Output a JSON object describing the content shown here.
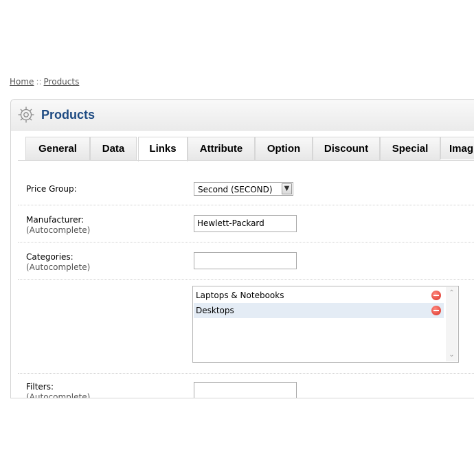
{
  "breadcrumb": {
    "home": "Home",
    "separator": "::",
    "products": "Products"
  },
  "heading": {
    "title": "Products",
    "icon": "gear-icon"
  },
  "tabs": [
    {
      "label": "General",
      "active": false
    },
    {
      "label": "Data",
      "active": false
    },
    {
      "label": "Links",
      "active": true
    },
    {
      "label": "Attribute",
      "active": false
    },
    {
      "label": "Option",
      "active": false
    },
    {
      "label": "Discount",
      "active": false
    },
    {
      "label": "Special",
      "active": false
    },
    {
      "label": "Imag",
      "active": false
    }
  ],
  "form": {
    "price_group": {
      "label": "Price Group:",
      "value": "Second (SECOND)"
    },
    "manufacturer": {
      "label": "Manufacturer:",
      "help": "(Autocomplete)",
      "value": "Hewlett-Packard"
    },
    "categories": {
      "label": "Categories:",
      "help": "(Autocomplete)",
      "value": ""
    },
    "category_list": [
      "Laptops & Notebooks",
      "Desktops"
    ],
    "filters": {
      "label": "Filters:",
      "help": "(Autocomplete)",
      "value": ""
    }
  },
  "colors": {
    "title": "#1d4a82",
    "row_highlight": "#e4ecf5",
    "remove": "#d93025"
  }
}
